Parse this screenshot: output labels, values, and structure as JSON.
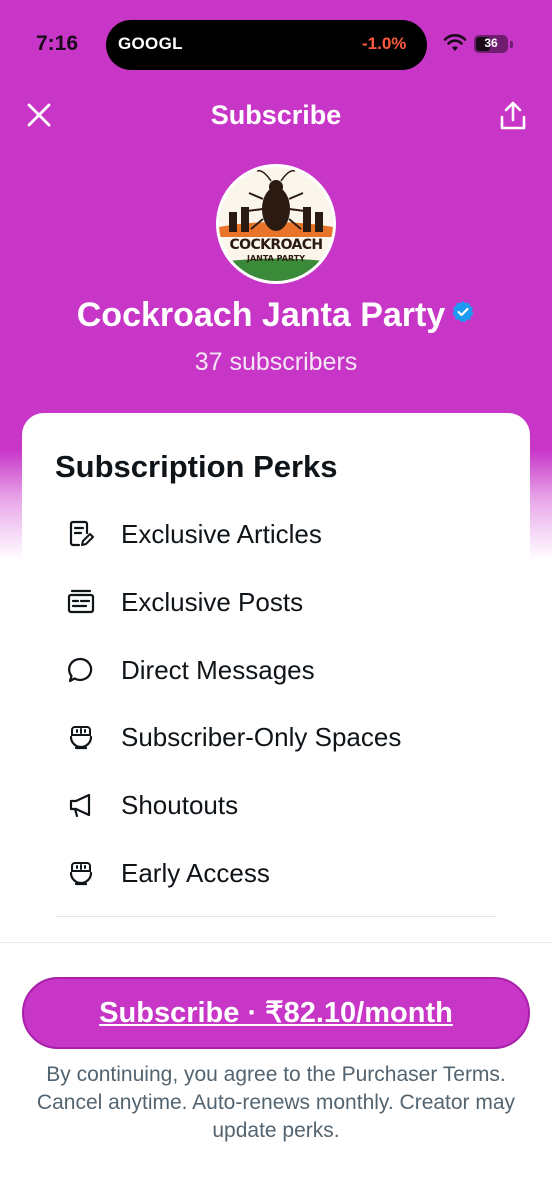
{
  "status_bar": {
    "time": "7:16",
    "ticker_symbol": "GOOGL",
    "ticker_change": "-1.0%",
    "battery": "36"
  },
  "nav": {
    "title": "Subscribe"
  },
  "creator": {
    "avatar_text_line1": "COCKROACH",
    "avatar_text_line2": "JANTA PARTY",
    "name": "Cockroach Janta Party",
    "subscribers": "37 subscribers"
  },
  "perks": {
    "title": "Subscription Perks",
    "items": [
      {
        "label": "Exclusive Articles",
        "icon": "article-icon"
      },
      {
        "label": "Exclusive Posts",
        "icon": "posts-icon"
      },
      {
        "label": "Direct Messages",
        "icon": "message-icon"
      },
      {
        "label": "Subscriber-Only Spaces",
        "icon": "spaces-icon"
      },
      {
        "label": "Shoutouts",
        "icon": "megaphone-icon"
      },
      {
        "label": "Early Access",
        "icon": "early-access-icon"
      }
    ]
  },
  "footer": {
    "cta": "Subscribe · ₹82.10/month",
    "terms": "By continuing, you agree to the Purchaser Terms. Cancel anytime. Auto-renews monthly. Creator may update perks."
  },
  "colors": {
    "brand": "#c836c8",
    "verified": "#1d9bf0",
    "ticker_negative": "#ff5a3c"
  }
}
